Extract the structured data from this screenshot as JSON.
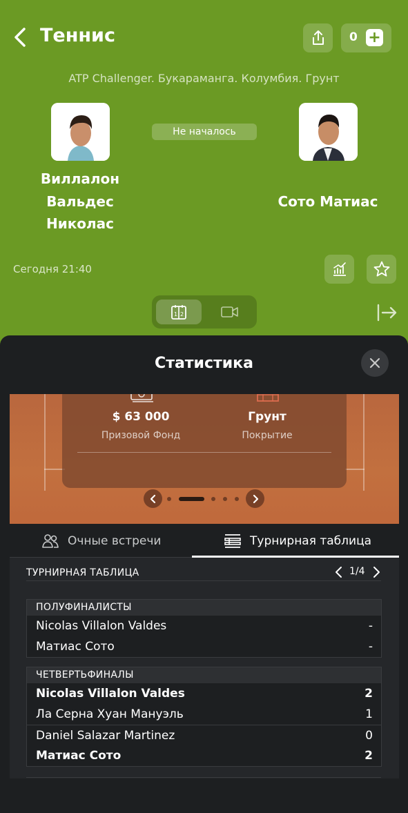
{
  "header": {
    "title": "Теннис",
    "coupon_count": "0",
    "tournament": "ATP Challenger. Букараманга. Колумбия. Грунт",
    "status": "Не началось",
    "time": "Сегодня 21:40"
  },
  "players": {
    "home": {
      "name": "Виллалон Вальдес Николас"
    },
    "away": {
      "name": "Сото Матиас"
    }
  },
  "sheet": {
    "title": "Статистика",
    "info_card": {
      "prize_value": "$ 63 000",
      "prize_label": "Призовой Фонд",
      "surface_value": "Грунт",
      "surface_label": "Покрытие"
    },
    "tabs": [
      {
        "label": "Очные встречи"
      },
      {
        "label": "Турнирная таблица"
      }
    ],
    "standings": {
      "title": "ТУРНИРНАЯ ТАБЛИЦА",
      "page": "1/4",
      "groups": [
        {
          "title": "ПОЛУФИНАЛИСТЫ",
          "rows": [
            {
              "name": "Nicolas Villalon Valdes",
              "score": "-"
            },
            {
              "name": "Матиас Сото",
              "score": "-"
            }
          ]
        },
        {
          "title": "ЧЕТВЕРТЬФИНАЛЫ",
          "rows": [
            {
              "name": "Nicolas Villalon Valdes",
              "score": "2"
            },
            {
              "name": "Ла Серна Хуан Мануэль",
              "score": "1"
            },
            {
              "name": "Daniel Salazar Martinez",
              "score": "0"
            },
            {
              "name": "Матиас Сото",
              "score": "2"
            }
          ]
        }
      ]
    }
  },
  "colors": {
    "brand_green": "#6b9a24",
    "sheet_bg": "#1d1f21",
    "court": "#c2703f"
  }
}
